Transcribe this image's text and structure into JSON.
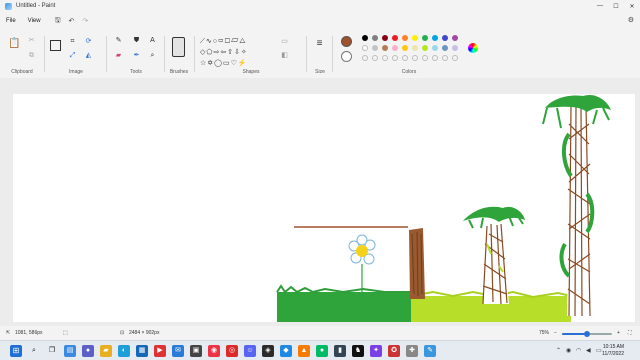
{
  "window": {
    "title": "Untitled - Paint",
    "controls": [
      "minimize-icon",
      "maximize-icon",
      "close-icon"
    ]
  },
  "menu": {
    "file": "File",
    "view": "View"
  },
  "quick_access": [
    "save-icon",
    "undo-icon",
    "redo-icon"
  ],
  "ribbon": {
    "groups": {
      "clipboard": "Clipboard",
      "image": "Image",
      "tools": "Tools",
      "brushes": "Brushes",
      "shapes": "Shapes",
      "size": "Size",
      "colors": "Colors"
    },
    "selected_color": "#a0522d",
    "palette_row1": [
      "#000000",
      "#7f7f7f",
      "#880015",
      "#ed1c24",
      "#ff7f27",
      "#fff200",
      "#22b14c",
      "#00a2e8",
      "#3f48cc",
      "#a349a4"
    ],
    "palette_row2": [
      "#ffffff",
      "#c3c3c3",
      "#b97a57",
      "#ffaec9",
      "#ffc90e",
      "#efe4b0",
      "#b5e61d",
      "#99d9ea",
      "#7092be",
      "#c8bfe7"
    ]
  },
  "status": {
    "cursor_pos": "1081, 586px",
    "canvas_size": "2484 × 902px",
    "zoom": "75%",
    "zoom_level": 0.75
  },
  "taskbar": {
    "time": "10:15 AM",
    "date": "11/7/2022"
  }
}
